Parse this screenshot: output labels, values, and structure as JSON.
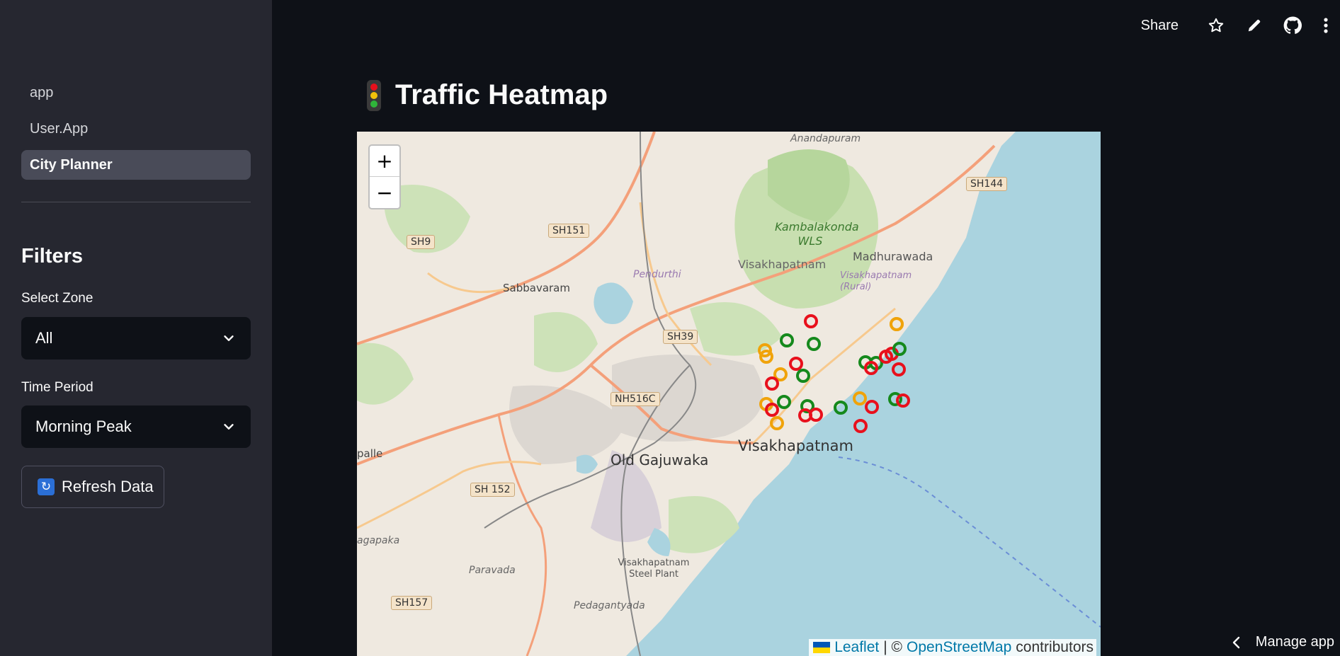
{
  "sidebar": {
    "nav": [
      {
        "label": "app",
        "active": false
      },
      {
        "label": "User.App",
        "active": false
      },
      {
        "label": "City Planner",
        "active": true
      }
    ],
    "filters_title": "Filters",
    "zone": {
      "label": "Select Zone",
      "value": "All"
    },
    "period": {
      "label": "Time Period",
      "value": "Morning Peak"
    },
    "refresh_label": "Refresh Data"
  },
  "toolbar": {
    "share": "Share",
    "icons": [
      "star-icon",
      "pencil-icon",
      "github-icon",
      "more-vertical-icon"
    ]
  },
  "main": {
    "title": "Traffic Heatmap",
    "title_icon": "traffic-light-icon"
  },
  "map": {
    "zoom_in": "+",
    "zoom_out": "−",
    "attribution": {
      "leaflet": "Leaflet",
      "separator": "| ©",
      "osm": "OpenStreetMap",
      "suffix": "contributors"
    },
    "place_labels": [
      "Anandapuram",
      "Kambalakonda WLS",
      "Madhurawada",
      "Visakhapatnam",
      "Visakhapatnam (Rural)",
      "Sabbavaram",
      "Pendurthi",
      "Old Gajuwaka",
      "Visakhapatnam",
      "Visakhapatnam Steel Plant",
      "Paravada",
      "Pedagantyada",
      "agapaka",
      "palle"
    ],
    "road_shields": [
      "SH144",
      "SH151",
      "SH9",
      "SH39",
      "NH516C",
      "SH 152",
      "SH157"
    ],
    "status_colors": {
      "high": "#e8101c",
      "medium": "#f0a30a",
      "low": "#15891c"
    },
    "markers": [
      {
        "level": "high"
      },
      {
        "level": "medium"
      },
      {
        "level": "medium"
      },
      {
        "level": "low"
      },
      {
        "level": "medium"
      },
      {
        "level": "low"
      },
      {
        "level": "high"
      },
      {
        "level": "medium"
      },
      {
        "level": "low"
      },
      {
        "level": "high"
      },
      {
        "level": "medium"
      },
      {
        "level": "high"
      },
      {
        "level": "low"
      },
      {
        "level": "low"
      },
      {
        "level": "high"
      },
      {
        "level": "high"
      },
      {
        "level": "medium"
      },
      {
        "level": "low"
      },
      {
        "level": "medium"
      },
      {
        "level": "low"
      },
      {
        "level": "high"
      },
      {
        "level": "low"
      },
      {
        "level": "high"
      },
      {
        "level": "high"
      },
      {
        "level": "high"
      },
      {
        "level": "low"
      },
      {
        "level": "high"
      },
      {
        "level": "medium"
      },
      {
        "level": "low"
      },
      {
        "level": "high"
      },
      {
        "level": "high"
      }
    ]
  },
  "footer": {
    "manage": "Manage app"
  }
}
